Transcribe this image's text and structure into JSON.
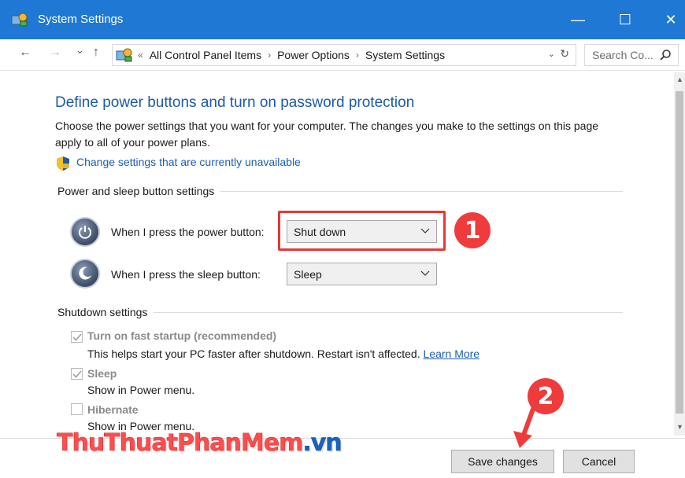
{
  "window": {
    "title": "System Settings",
    "controls": {
      "minimize": "—",
      "maximize": "☐",
      "close": "✕"
    }
  },
  "nav": {
    "back": "←",
    "forward": "→",
    "recent": "⌄",
    "up": "↑"
  },
  "address": {
    "overflow": "«",
    "crumbs": [
      "All Control Panel Items",
      "Power Options",
      "System Settings"
    ],
    "separator": "›"
  },
  "search": {
    "placeholder": "Search Co..."
  },
  "content": {
    "heading": "Define power buttons and turn on password protection",
    "description": "Choose the power settings that you want for your computer. The changes you make to the settings on this page apply to all of your power plans.",
    "change_link": "Change settings that are currently unavailable"
  },
  "power_sleep": {
    "group_label": "Power and sleep button settings",
    "power_label": "When I press the power button:",
    "power_value": "Shut down",
    "sleep_label": "When I press the sleep button:",
    "sleep_value": "Sleep"
  },
  "shutdown": {
    "group_label": "Shutdown settings",
    "fast_startup_label": "Turn on fast startup (recommended)",
    "fast_startup_desc": "This helps start your PC faster after shutdown. Restart isn't affected.",
    "learn_more": "Learn More",
    "sleep_label": "Sleep",
    "sleep_desc": "Show in Power menu.",
    "hibernate_label": "Hibernate",
    "hibernate_desc": "Show in Power menu.",
    "fast_startup_checked": true,
    "sleep_checked": true,
    "hibernate_checked": false
  },
  "annotations": {
    "marker1": "1",
    "marker2": "2",
    "color": "#ef3b3b"
  },
  "watermark": {
    "part1": "ThuThuat",
    "part2": "PhanMem",
    "part3": ".vn"
  },
  "footer": {
    "save": "Save changes",
    "cancel": "Cancel"
  },
  "colors": {
    "titlebar": "#1e78d4",
    "heading": "#1e5aa8",
    "link": "#1a5fb4"
  }
}
